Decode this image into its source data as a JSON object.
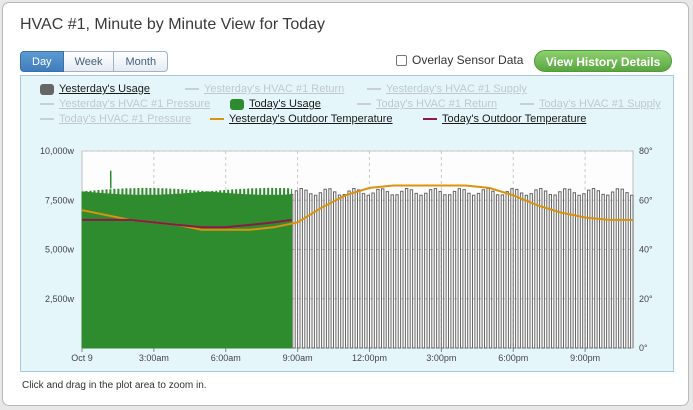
{
  "title": "HVAC #1, Minute by Minute View for Today",
  "range_tabs": [
    {
      "label": "Day",
      "active": true
    },
    {
      "label": "Week",
      "active": false
    },
    {
      "label": "Month",
      "active": false
    }
  ],
  "overlay_label": "Overlay Sensor Data",
  "history_button": "View History Details",
  "hint": "Click and drag in the plot area to zoom in.",
  "legend": [
    {
      "label": "Yesterday's Usage",
      "kind": "box",
      "color": "#666666",
      "on": true
    },
    {
      "label": "Yesterday's HVAC #1 Return",
      "kind": "line",
      "color": "#c8d0d3",
      "on": false
    },
    {
      "label": "Yesterday's HVAC #1 Supply",
      "kind": "line",
      "color": "#c8d0d3",
      "on": false
    },
    {
      "label": "Yesterday's HVAC #1 Pressure",
      "kind": "line",
      "color": "#c8d0d3",
      "on": false
    },
    {
      "label": "Today's Usage",
      "kind": "box",
      "color": "#2e8b2e",
      "on": true
    },
    {
      "label": "Today's HVAC #1 Return",
      "kind": "line",
      "color": "#c8d0d3",
      "on": false
    },
    {
      "label": "Today's HVAC #1 Supply",
      "kind": "line",
      "color": "#c8d0d3",
      "on": false
    },
    {
      "label": "Today's HVAC #1 Pressure",
      "kind": "line",
      "color": "#c8d0d3",
      "on": false
    },
    {
      "label": "Yesterday's Outdoor Temperature",
      "kind": "line",
      "color": "#d9930e",
      "on": true
    },
    {
      "label": "Today's Outdoor Temperature",
      "kind": "line",
      "color": "#8b1a4a",
      "on": true
    }
  ],
  "chart_data": {
    "type": "line",
    "x_ticks": [
      "Oct 9",
      "3:00am",
      "6:00am",
      "9:00am",
      "12:00pm",
      "3:00pm",
      "6:00pm",
      "9:00pm"
    ],
    "x_range_hours": [
      0,
      23
    ],
    "y_left": {
      "ticks": [
        "10,000w",
        "7,500w",
        "5,000w",
        "2,500w"
      ],
      "range": [
        0,
        10000
      ]
    },
    "y_right": {
      "ticks": [
        "80°",
        "60°",
        "40°",
        "20°",
        "0°"
      ],
      "range": [
        0,
        80
      ]
    },
    "grid": true,
    "series": [
      {
        "name": "Yesterday's Usage",
        "kind": "cycling",
        "color": "#666666",
        "x_range": [
          8.5,
          23
        ],
        "on_watts": 8100,
        "off_watts": 0,
        "period_minutes": 12
      },
      {
        "name": "Today's Usage",
        "kind": "cycling",
        "color": "#2e8b2e",
        "x_range": [
          0,
          8.75
        ],
        "on_watts": 8100,
        "off_watts": 0,
        "period_minutes": 5,
        "spike": {
          "x": 1.2,
          "y": 9000
        }
      },
      {
        "name": "Yesterday's Outdoor Temperature",
        "color": "#d9930e",
        "x": [
          0,
          2,
          4,
          5,
          6,
          7,
          8,
          9,
          10,
          11,
          12,
          13,
          14,
          15,
          16,
          17,
          18,
          19,
          20,
          21,
          22,
          23
        ],
        "y": [
          56,
          52,
          50,
          48,
          48,
          48,
          49,
          51,
          57,
          62,
          65,
          66,
          66,
          66,
          66,
          65,
          62,
          58,
          55,
          53,
          52,
          52
        ]
      },
      {
        "name": "Today's Outdoor Temperature",
        "color": "#8b1a4a",
        "x": [
          0,
          1,
          2,
          3,
          4,
          5,
          6,
          7,
          8,
          8.75
        ],
        "y": [
          52,
          52,
          52,
          51,
          50,
          49,
          49,
          50,
          51,
          52
        ]
      }
    ]
  }
}
